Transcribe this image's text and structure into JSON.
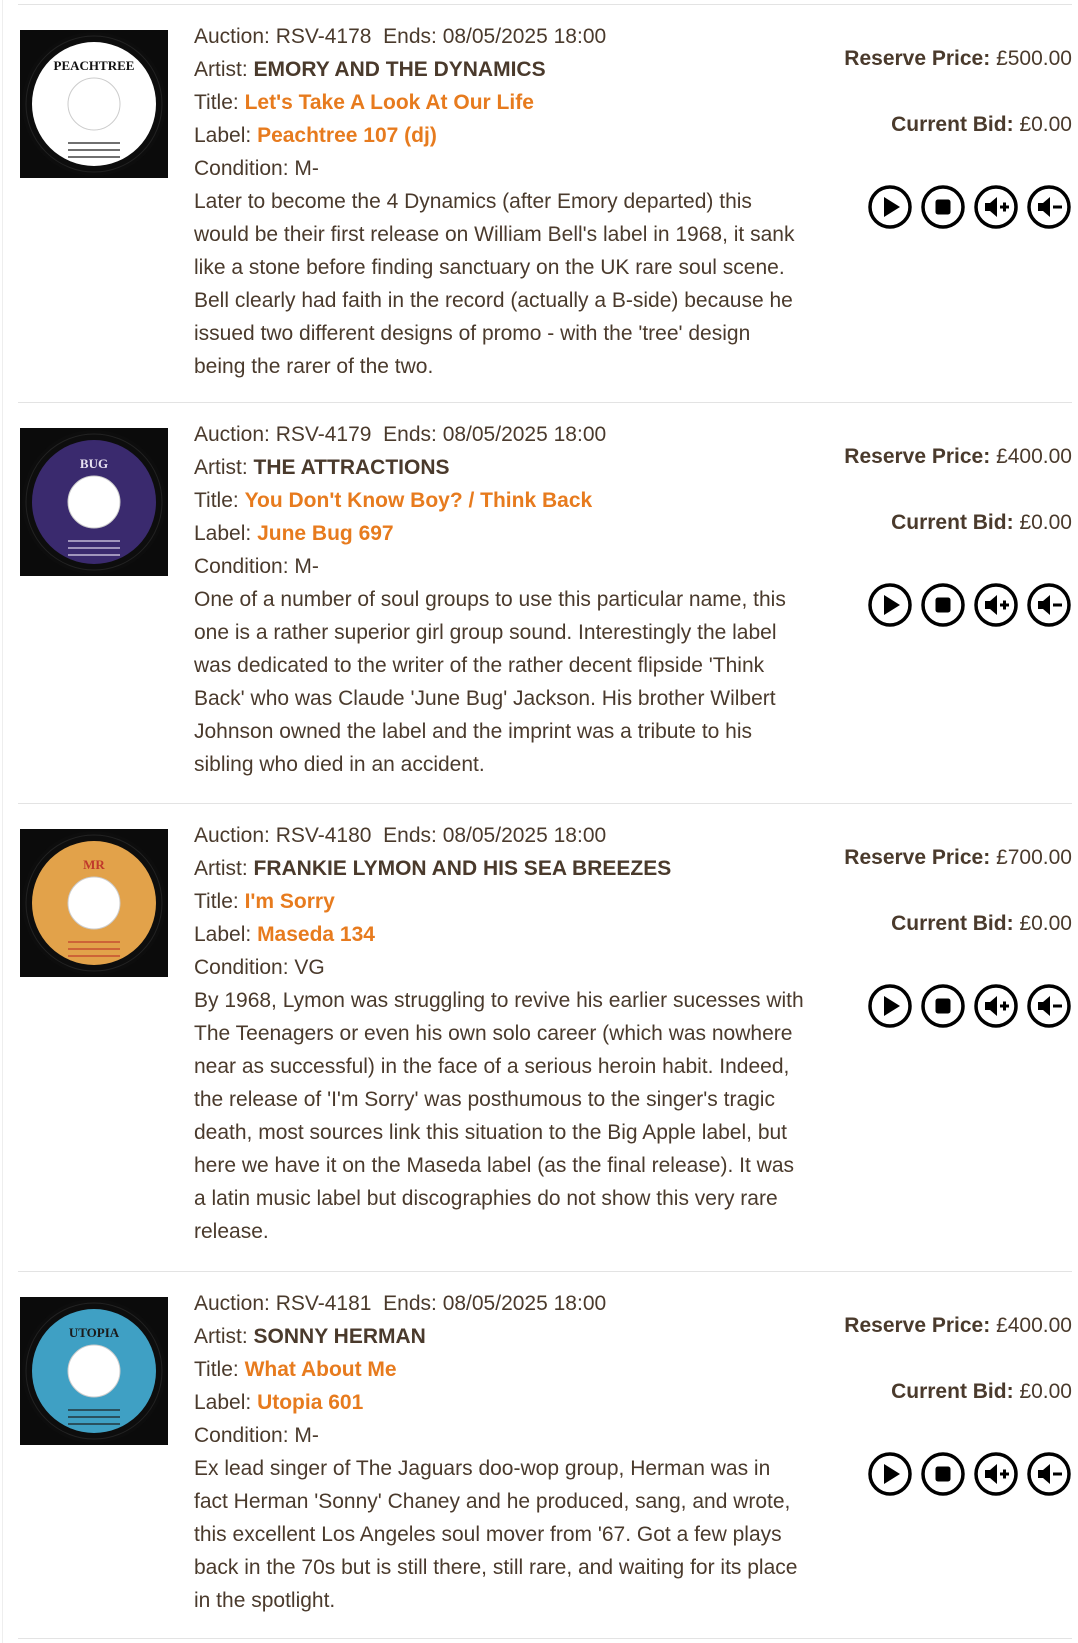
{
  "auctions": [
    {
      "auction_label": "Auction:",
      "auction_id": "RSV-4178",
      "ends_label": "Ends:",
      "ends": "08/05/2025 18:00",
      "artist_label": "Artist:",
      "artist": "EMORY AND THE DYNAMICS",
      "title_label": "Title:",
      "title": "Let's Take A Look At Our Life",
      "label_label": "Label:",
      "label": "Peachtree 107 (dj)",
      "condition_label": "Condition:",
      "condition": "M-",
      "description": "Later to become the 4 Dynamics (after Emory departed) this would be their first release on William Bell's label in 1968, it sank like a stone before finding sanctuary on the UK rare soul scene. Bell clearly had faith in the record (actually a B-side) because he issued two different designs of promo - with the 'tree' design being the rarer of the two.",
      "reserve_label": "Reserve Price:",
      "reserve": "£500.00",
      "bid_label": "Current Bid:",
      "bid": "£0.00",
      "record_image": {
        "icon": "record-label-image",
        "label_color": "#ffffff",
        "brand_text": "PEACHTREE",
        "colors": {
          "vinyl": "#0d0d0d",
          "label": "#ffffff",
          "text": "#111111"
        }
      }
    },
    {
      "auction_label": "Auction:",
      "auction_id": "RSV-4179",
      "ends_label": "Ends:",
      "ends": "08/05/2025 18:00",
      "artist_label": "Artist:",
      "artist": "THE ATTRACTIONS",
      "title_label": "Title:",
      "title": "You Don't Know Boy? / Think Back",
      "label_label": "Label:",
      "label": "June Bug 697",
      "condition_label": "Condition:",
      "condition": "M-",
      "description": "One of a number of soul groups to use this particular name, this one is a rather superior girl group sound. Interestingly the label was dedicated to the writer of the rather decent flipside 'Think Back' who was Claude 'June Bug' Jackson. His brother Wilbert Johnson owned the label and the imprint was a tribute to his sibling who died in an accident.",
      "reserve_label": "Reserve Price:",
      "reserve": "£400.00",
      "bid_label": "Current Bid:",
      "bid": "£0.00",
      "record_image": {
        "icon": "record-label-image",
        "brand_text": "BUG",
        "colors": {
          "vinyl": "#0d0d0d",
          "label": "#3a2a6e",
          "text": "#e6e0f0"
        }
      }
    },
    {
      "auction_label": "Auction:",
      "auction_id": "RSV-4180",
      "ends_label": "Ends:",
      "ends": "08/05/2025 18:00",
      "artist_label": "Artist:",
      "artist": "FRANKIE LYMON AND HIS SEA BREEZES",
      "title_label": "Title:",
      "title": "I'm Sorry",
      "label_label": "Label:",
      "label": "Maseda 134",
      "condition_label": "Condition:",
      "condition": "VG",
      "description": "By 1968, Lymon was struggling to revive his earlier sucesses with The Teenagers or even his own solo career (which was nowhere near as successful) in the face of a serious heroin habit. Indeed, the release of 'I'm Sorry' was posthumous to the singer's tragic death, most sources link this situation to the Big Apple label, but here we have it on the Maseda label (as the final release). It was a latin music label but discographies do not show this very rare release.",
      "reserve_label": "Reserve Price:",
      "reserve": "£700.00",
      "bid_label": "Current Bid:",
      "bid": "£0.00",
      "record_image": {
        "icon": "record-label-image",
        "brand_text": "MR",
        "colors": {
          "vinyl": "#0d0d0d",
          "label": "#e2a24a",
          "text": "#c0392b"
        }
      }
    },
    {
      "auction_label": "Auction:",
      "auction_id": "RSV-4181",
      "ends_label": "Ends:",
      "ends": "08/05/2025 18:00",
      "artist_label": "Artist:",
      "artist": "SONNY HERMAN",
      "title_label": "Title:",
      "title": "What About Me",
      "label_label": "Label:",
      "label": "Utopia 601",
      "condition_label": "Condition:",
      "condition": "M-",
      "description": "Ex lead singer of The Jaguars doo-wop group, Herman was in fact Herman 'Sonny' Chaney and he produced, sang, and wrote, this excellent Los Angeles soul mover from '67. Got a few plays back in the 70s but is still there, still rare, and waiting for its place in the spotlight.",
      "reserve_label": "Reserve Price:",
      "reserve": "£400.00",
      "bid_label": "Current Bid:",
      "bid": "£0.00",
      "record_image": {
        "icon": "record-label-image",
        "brand_text": "UTOPIA",
        "colors": {
          "vinyl": "#0d0d0d",
          "label": "#3fa0c4",
          "text": "#1a1a1a"
        }
      }
    }
  ],
  "player_controls": [
    {
      "icon": "play-icon",
      "action": "play"
    },
    {
      "icon": "stop-icon",
      "action": "stop"
    },
    {
      "icon": "volume-up-icon",
      "action": "volume up"
    },
    {
      "icon": "volume-down-icon",
      "action": "volume down"
    }
  ],
  "colors": {
    "text": "#4a3a2c",
    "link": "#e77b1e",
    "divider": "#e3e3e3"
  }
}
